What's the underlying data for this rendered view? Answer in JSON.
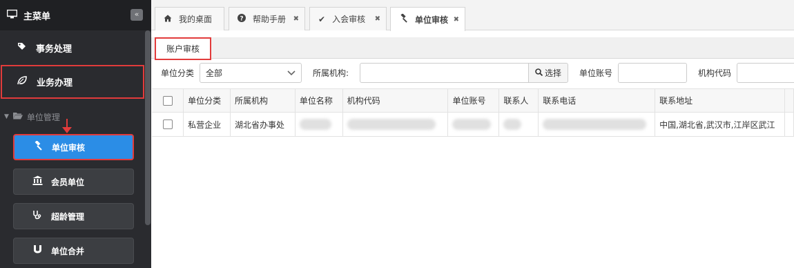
{
  "sidebar": {
    "title": "主菜单",
    "items": [
      {
        "label": "事务处理"
      },
      {
        "label": "业务办理"
      }
    ],
    "group": {
      "label": "单位管理"
    },
    "subitems": [
      {
        "label": "单位审核"
      },
      {
        "label": "会员单位"
      },
      {
        "label": "超龄管理"
      },
      {
        "label": "单位合并"
      }
    ]
  },
  "tabs": [
    {
      "label": "我的桌面"
    },
    {
      "label": "帮助手册"
    },
    {
      "label": "入会审核"
    },
    {
      "label": "单位审核"
    }
  ],
  "subtab": {
    "label": "账户审核"
  },
  "filters": {
    "category_label": "单位分类",
    "category_value": "全部",
    "org_label": "所属机构:",
    "select_button": "选择",
    "account_label": "单位账号",
    "code_label": "机构代码"
  },
  "table": {
    "columns": [
      "单位分类",
      "所属机构",
      "单位名称",
      "机构代码",
      "单位账号",
      "联系人",
      "联系电话",
      "联系地址"
    ],
    "rows": [
      {
        "category": "私营企业",
        "org": "湖北省办事处",
        "address": "中国,湖北省,武汉市,江岸区武江"
      }
    ]
  },
  "colors": {
    "accent": "#2b8de6",
    "highlight": "#e23b3b",
    "sidebar_bg": "#2a2b2f"
  }
}
